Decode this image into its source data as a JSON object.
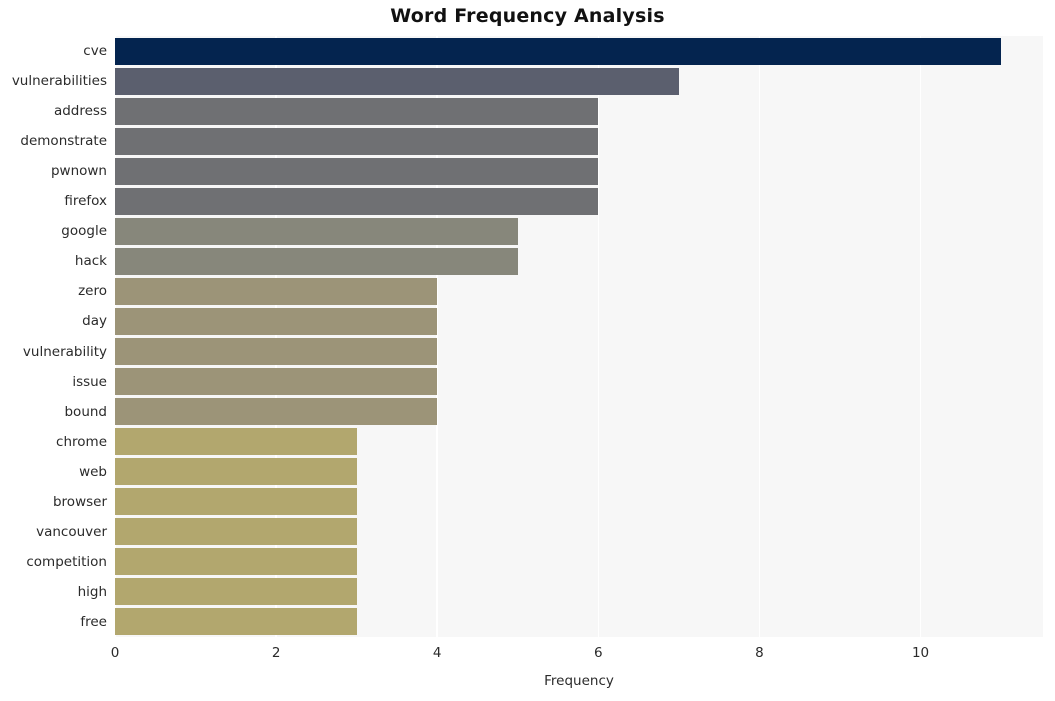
{
  "chart_data": {
    "type": "bar",
    "orientation": "horizontal",
    "title": "Word Frequency Analysis",
    "xlabel": "Frequency",
    "ylabel": "",
    "xlim": [
      0,
      11.52
    ],
    "xticks": [
      0,
      2,
      4,
      6,
      8,
      10
    ],
    "xtick_labels": [
      "0",
      "2",
      "4",
      "6",
      "8",
      "10"
    ],
    "grid": "vertical-white",
    "legend": "none",
    "background": "#f7f7f7",
    "categories": [
      "cve",
      "vulnerabilities",
      "address",
      "demonstrate",
      "pwnown",
      "firefox",
      "google",
      "hack",
      "zero",
      "day",
      "vulnerability",
      "issue",
      "bound",
      "chrome",
      "web",
      "browser",
      "vancouver",
      "competition",
      "high",
      "free"
    ],
    "values": [
      11,
      7,
      6,
      6,
      6,
      6,
      5,
      5,
      4,
      4,
      4,
      4,
      4,
      3,
      3,
      3,
      3,
      3,
      3,
      3
    ],
    "bar_colors": [
      "#04244f",
      "#5b5f6e",
      "#6f7073",
      "#6f7073",
      "#6f7073",
      "#6f7073",
      "#87877b",
      "#87877b",
      "#9c9478",
      "#9c9478",
      "#9c9478",
      "#9c9478",
      "#9c9478",
      "#b2a76e",
      "#b2a76e",
      "#b2a76e",
      "#b2a76e",
      "#b2a76e",
      "#b2a76e",
      "#b2a76e"
    ]
  }
}
